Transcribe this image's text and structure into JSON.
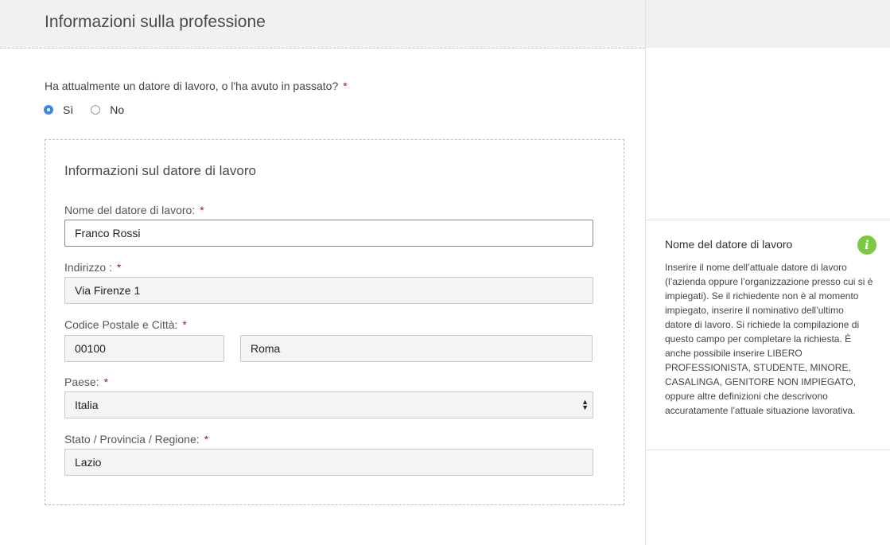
{
  "header": {
    "title": "Informazioni sulla professione"
  },
  "question": {
    "text": "Ha attualmente un datore di lavoro, o l'ha avuto in passato?",
    "required_mark": "*",
    "options": [
      {
        "label": "Sì",
        "checked": true
      },
      {
        "label": "No",
        "checked": false
      }
    ]
  },
  "employer": {
    "title": "Informazioni sul datore di lavoro",
    "name": {
      "label": "Nome del datore di lavoro:",
      "required_mark": "*",
      "value": "Franco Rossi"
    },
    "address": {
      "label": "Indirizzo :",
      "required_mark": "*",
      "value": "Via Firenze 1"
    },
    "postal_city": {
      "label": "Codice Postale e Città:",
      "required_mark": "*",
      "postal_value": "00100",
      "city_value": "Roma"
    },
    "country": {
      "label": "Paese:",
      "required_mark": "*",
      "selected": "Italia"
    },
    "region": {
      "label": "Stato / Provincia / Regione:",
      "required_mark": "*",
      "value": "Lazio"
    }
  },
  "help": {
    "title": "Nome del datore di lavoro",
    "icon": "info-icon",
    "icon_color": "#7ac943",
    "text": "Inserire il nome dell’attuale datore di lavoro (l’azienda oppure l’organizzazione presso cui si è impiegati). Se il richiedente non è al momento impiegato, inserire il nominativo dell’ultimo datore di lavoro. Si richiede la compilazione di questo campo per completare la richiesta. È anche possibile inserire LIBERO PROFESSIONISTA, STUDENTE, MINORE, CASALINGA, GENITORE NON IMPIEGATO, oppure altre definizioni che descrivono accuratamente l’attuale situazione lavorativa."
  },
  "colors": {
    "accent": "#3b86e6",
    "required": "#d0021b",
    "header_bg": "#f1f1f1"
  }
}
